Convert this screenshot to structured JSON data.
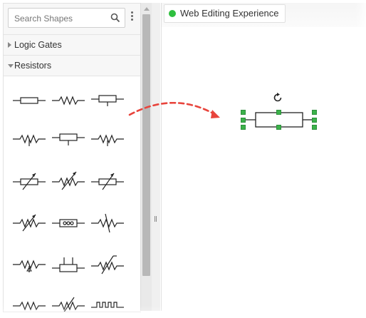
{
  "search": {
    "placeholder": "Search Shapes"
  },
  "categories": [
    {
      "label": "Logic Gates",
      "state": "collapsed"
    },
    {
      "label": "Resistors",
      "state": "expanded"
    }
  ],
  "resistor_shapes": [
    "resistor",
    "resistor-zigzag",
    "resistor-tapped",
    "resistor-zigzag-tap",
    "resistor-tap-bottom",
    "resistor-zigzag-tap-2",
    "variable-resistor",
    "variable-resistor-zigzag",
    "variable-resistor-2",
    "variable-resistor-zigzag-2",
    "resistor-dots",
    "resistor-zigzag-slash",
    "resistor-zigzag-arrow",
    "resistor-two-taps",
    "resistor-zigzag-slash-2",
    "resistor-zigzag-3",
    "resistor-zigzag-slash-3",
    "resistor-meander"
  ],
  "document": {
    "title": "Web Editing Experience",
    "status_color": "#2fbf3f"
  },
  "colors": {
    "selection_handle": "#3bb24a",
    "drag_arrow": "#e8443c"
  },
  "icons": {
    "search": "search-icon",
    "menu": "kebab-menu-icon",
    "rotate": "rotate-icon"
  }
}
